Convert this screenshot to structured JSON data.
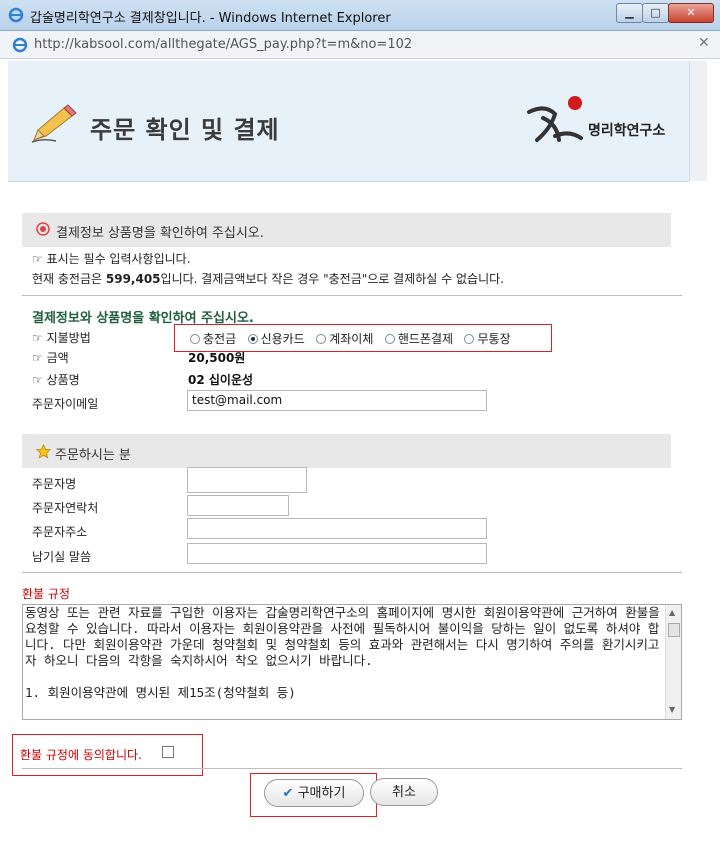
{
  "window": {
    "title": "갑술명리학연구소 결제창입니다. - Windows Internet Explorer",
    "url": "http://kabsool.com/allthegate/AGS_pay.php?t=m&no=102"
  },
  "header": {
    "title": "주문 확인 및 결제",
    "logo_text": "명리학연구소"
  },
  "section1": {
    "title": "결제정보 상품명을 확인하여 주십시오.",
    "note": "표시는 필수 입력사항입니다.",
    "balance_prefix": "현재 충전금은 ",
    "balance_amount": "599,405",
    "balance_suffix": "입니다. 결제금액보다 작은 경우 \"충전금\"으로 결제하실 수 없습니다."
  },
  "payment": {
    "heading": "결제정보와 상품명을 확인하여 주십시오.",
    "method_label": "지불방법",
    "methods": [
      "충전금",
      "신용카드",
      "계좌이체",
      "핸드폰결제",
      "무통장"
    ],
    "selected_method": "신용카드",
    "amount_label": "금액",
    "amount": "20,500원",
    "product_label": "상품명",
    "product": "02 십이운성",
    "email_label": "주문자이메일",
    "email": "test@mail.com"
  },
  "orderer": {
    "title": "주문하시는 분",
    "name_label": "주문자명",
    "name": "",
    "phone_label": "주문자연락처",
    "phone": "",
    "address_label": "주문자주소",
    "address": "",
    "message_label": "남기실 말씀",
    "message": ""
  },
  "refund": {
    "title": "환불 규정",
    "text": "동영상 또는 관련 자료를 구입한 이용자는 갑술명리학연구소의 홈페이지에 명시한 회원이용약관에 근거하여 환불을 요청할 수 있습니다. 따라서 이용자는 회원이용약관을 사전에 필독하시어 불이익을 당하는 일이 없도록 하셔야 합니다. 다만 회원이용약관 가운데 청약철회 및 청약철회 등의 효과와 관련해서는 다시 명기하여 주의를 환기시키고자 하오니 다음의 각항을 숙지하시어 착오 없으시기 바랍니다.\n\n1. 회원이용약관에 명시된 제15조(청약철회 등)",
    "agree_label": "환불 규정에 동의합니다."
  },
  "buttons": {
    "buy": "구매하기",
    "cancel": "취소"
  },
  "colors": {
    "accent_red": "#cc0000",
    "heading_green": "#1f5f3f",
    "header_bg": "#e6f1f9"
  }
}
